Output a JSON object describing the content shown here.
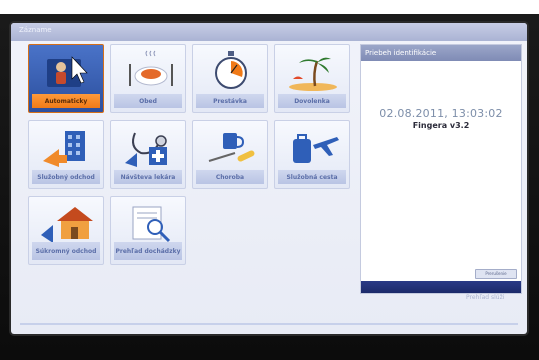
{
  "window": {
    "header_text": "Zázname",
    "panel_title": "Priebeh identifikácie",
    "datetime": "02.08.2011, 13:03:02",
    "version": "Fingera v3.2",
    "panel_button": "Prerušenie",
    "panel_link": "Prehľad slúži"
  },
  "tiles": [
    {
      "label": "Automaticky",
      "icon": "user-cursor-icon",
      "active": true
    },
    {
      "label": "Obed",
      "icon": "lunch-plate-icon"
    },
    {
      "label": "Prestávka",
      "icon": "stopwatch-icon"
    },
    {
      "label": "Dovolenka",
      "icon": "beach-palm-icon"
    },
    {
      "label": "Služobný odchod",
      "icon": "building-arrow-icon"
    },
    {
      "label": "Návšteva lekára",
      "icon": "stethoscope-icon"
    },
    {
      "label": "Choroba",
      "icon": "medicine-cup-icon"
    },
    {
      "label": "Služobná cesta",
      "icon": "travel-suitcase-plane-icon"
    },
    {
      "label": "Súkromný odchod",
      "icon": "house-arrow-icon"
    },
    {
      "label": "Prehľad dochádzky",
      "icon": "report-magnifier-icon"
    }
  ]
}
